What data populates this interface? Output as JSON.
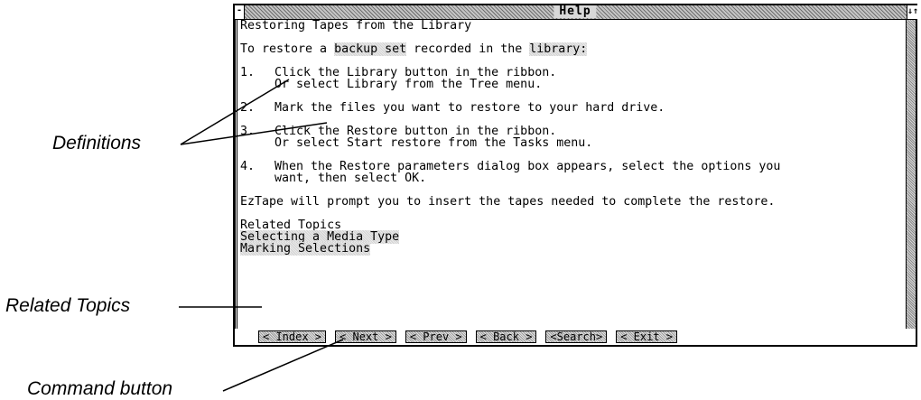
{
  "window": {
    "title": "Help",
    "system_menu_glyph": "-",
    "scroll_glyph": "↓↑"
  },
  "content": {
    "heading": "Restoring Tapes from the Library",
    "intro_before": "To restore a ",
    "intro_term1": "backup set",
    "intro_middle": " recorded in the ",
    "intro_term2": "library:",
    "steps": [
      {
        "num": "1.",
        "lines": [
          "Click the Library button in the ribbon.",
          "Or select Library from the Tree menu."
        ]
      },
      {
        "num": "2.",
        "lines": [
          "Mark the files you want to restore to your hard drive."
        ]
      },
      {
        "num": "3.",
        "lines": [
          "Click the Restore button in the ribbon.",
          "Or select Start restore from the Tasks menu."
        ]
      },
      {
        "num": "4.",
        "lines": [
          "When the Restore parameters dialog box appears, select the options you",
          "want, then select OK."
        ]
      }
    ],
    "prompt": "EzTape will prompt you to insert the tapes needed to complete the restore.",
    "related_heading": "Related Topics",
    "related_links": [
      "Selecting a Media Type",
      "Marking Selections"
    ]
  },
  "buttons": [
    "< Index >",
    "< Next >",
    "< Prev >",
    "< Back >",
    "<Search>",
    "< Exit >"
  ],
  "callouts": {
    "definitions": "Definitions",
    "related_topics": "Related Topics",
    "command_button": "Command button"
  }
}
